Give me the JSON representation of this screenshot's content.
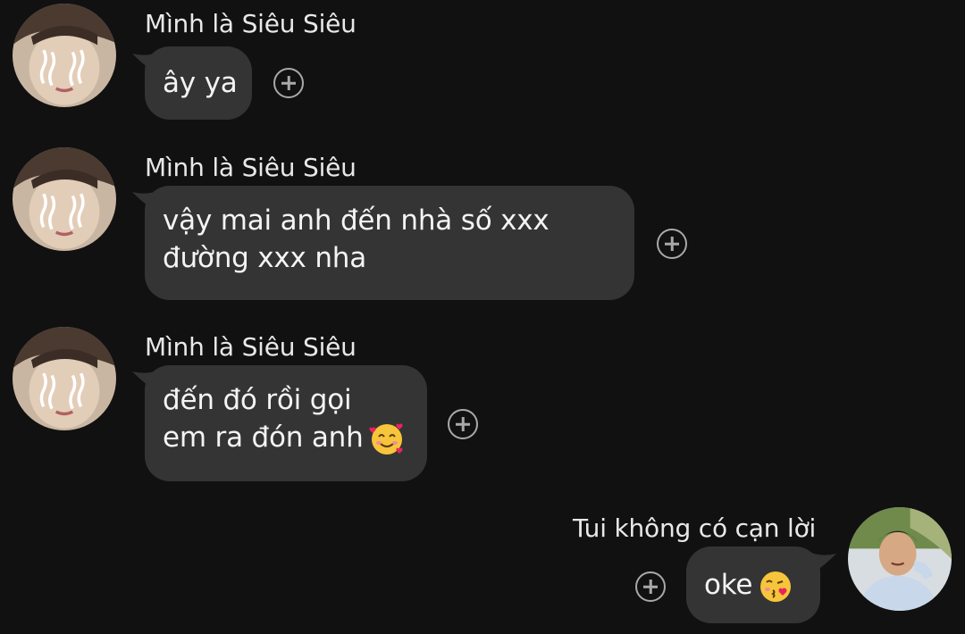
{
  "messages": [
    {
      "sender": "Mình là Siêu Siêu",
      "lines": [
        "ây ya"
      ],
      "emoji": ""
    },
    {
      "sender": "Mình là Siêu Siêu",
      "lines": [
        "vậy mai anh đến nhà số xxx",
        "đường xxx nha"
      ],
      "emoji": ""
    },
    {
      "sender": "Mình là Siêu Siêu",
      "lines": [
        "đến đó rồi gọi",
        "em ra đón anh"
      ],
      "emoji": "smiling-face-with-hearts"
    },
    {
      "sender": "Tui không có cạn lời",
      "lines": [
        "oke"
      ],
      "emoji": "face-blowing-kiss"
    }
  ],
  "colors": {
    "background": "#111111",
    "bubble": "#343434",
    "text": "#f4f4f4",
    "icon": "#a9a9a9"
  }
}
